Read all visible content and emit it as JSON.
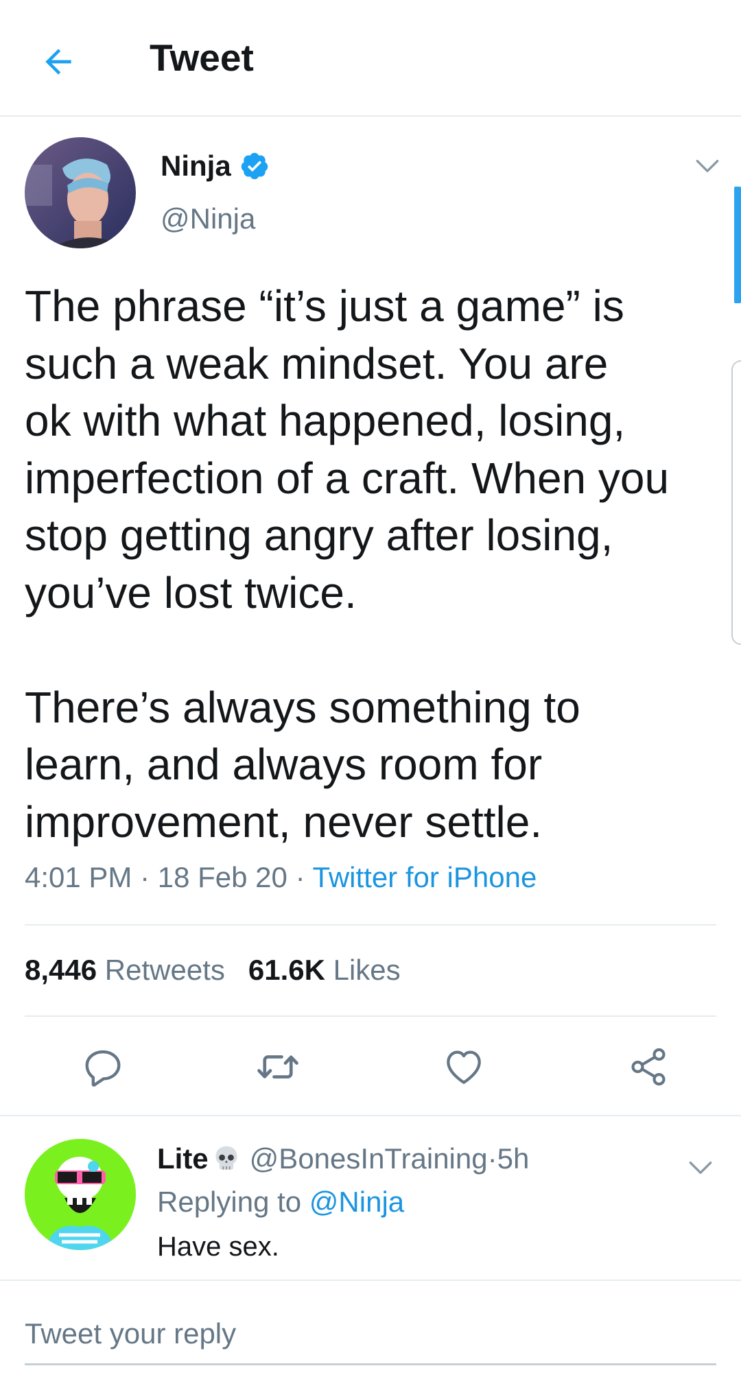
{
  "header": {
    "title": "Tweet",
    "back_icon": "arrow-left-icon"
  },
  "tweet": {
    "author_name": "Ninja",
    "author_handle": "@Ninja",
    "verified_icon": "verified-badge-icon",
    "text": "The phrase “it’s just a game” is\nsuch a weak mindset. You are\nok with what happened, losing,\nimperfection of a craft. When you\nstop getting angry after losing,\nyou’ve lost twice.\n\nThere’s always something to\nlearn, and always room for\nimprovement, never settle.",
    "time": "4:01 PM",
    "date": "18 Feb 20",
    "separator": " · ",
    "source": "Twitter for iPhone",
    "retweets_count": "8,446",
    "retweets_label": "Retweets",
    "likes_count": "61.6K",
    "likes_label": "Likes"
  },
  "actions": [
    {
      "icon": "reply-icon"
    },
    {
      "icon": "retweet-icon"
    },
    {
      "icon": "like-heart-icon"
    },
    {
      "icon": "share-icon"
    }
  ],
  "reply": {
    "name": "Lite",
    "emoji_icon": "skull-icon",
    "handle": "@BonesInTraining",
    "separator": " · ",
    "time": "5h",
    "replying_prefix": "Replying to ",
    "replying_to": "@Ninja",
    "text": "Have sex."
  },
  "compose": {
    "placeholder": "Tweet your reply"
  },
  "colors": {
    "accent": "#1b95e0",
    "verified": "#1da1f2",
    "muted": "#657786",
    "divider": "#e6ecf0",
    "scrollbar": "#2da3f0"
  }
}
